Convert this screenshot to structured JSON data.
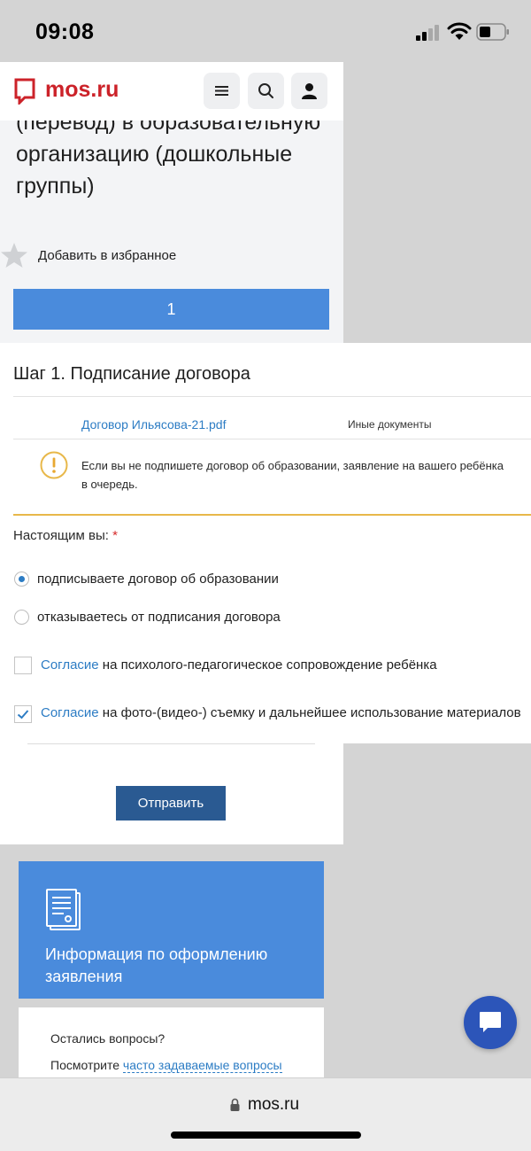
{
  "status_bar": {
    "time": "09:08"
  },
  "header": {
    "logo": "mos.ru"
  },
  "page": {
    "title": "(перевод) в образовательную организацию (дошкольные группы)",
    "favorite_label": "Добавить в избранное",
    "step_number": "1"
  },
  "step": {
    "heading": "Шаг 1. Подписание договора",
    "document_link": "Договор Ильясова-21.pdf",
    "document_type": "Иные документы",
    "warning_line1": "Если вы не подпишете договор об образовании, заявление на вашего ребёнка",
    "warning_line2": "в очередь.",
    "you_label": "Настоящим вы:",
    "required_mark": "*",
    "radio_sign": "подписываете договор об образовании",
    "radio_refuse": "отказываетесь от подписания договора",
    "consent_link": "Согласие",
    "consent1_rest": " на психолого-педагогическое сопровождение ребёнка",
    "consent2_rest": " на фото-(видео-) съемку и дальнейшее использование материалов",
    "submit_label": "Отправить"
  },
  "info": {
    "title": "Информация по оформлению заявления",
    "faq_question": "Остались вопросы?",
    "faq_prefix": "Посмотрите ",
    "faq_link": "часто задаваемые вопросы"
  },
  "browser": {
    "url": "mos.ru"
  },
  "colors": {
    "accent_blue": "#4a8bdc",
    "button_dark_blue": "#2a5a92",
    "link_blue": "#2c7cc4",
    "logo_red": "#cc2229",
    "warning_yellow": "#e8b84a",
    "chat_blue": "#2c55b9"
  },
  "icons": [
    "signal-icon",
    "wifi-icon",
    "battery-icon",
    "logo-icon",
    "menu-icon",
    "search-icon",
    "user-icon",
    "star-icon",
    "warning-icon",
    "checkmark-icon",
    "document-icon",
    "chat-icon",
    "lock-icon"
  ]
}
